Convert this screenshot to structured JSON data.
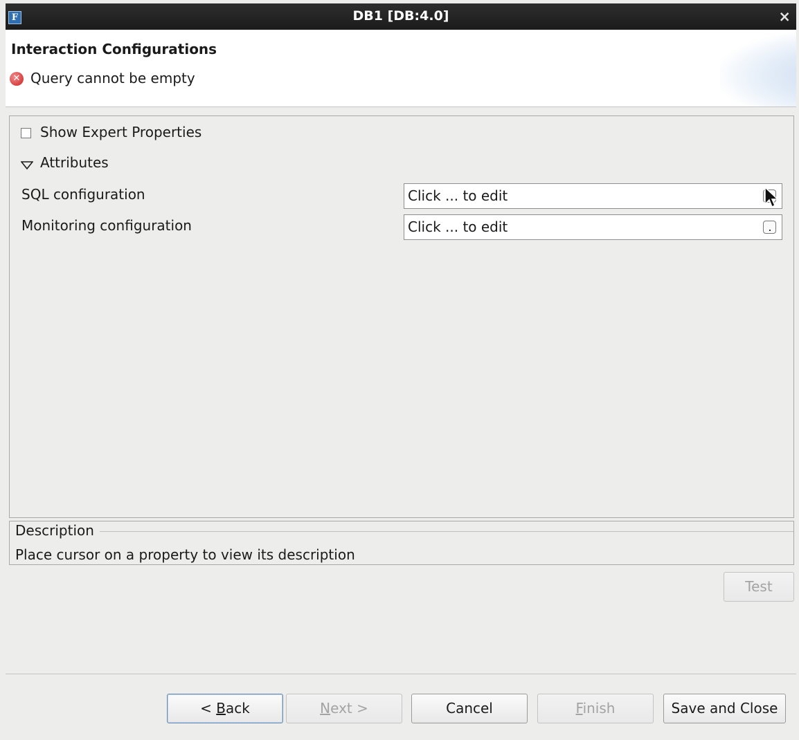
{
  "window": {
    "title": "DB1 [DB:4.0]",
    "app_icon": "F",
    "close_glyph": "×"
  },
  "header": {
    "title": "Interaction Configurations",
    "error_message": "Query cannot be empty",
    "error_icon": "error-icon",
    "error_glyph": "✕"
  },
  "properties": {
    "show_expert_label": "Show Expert Properties",
    "show_expert_checked": false,
    "section_label": "Attributes",
    "section_glyph": "▽",
    "rows": [
      {
        "label": "SQL configuration",
        "value": "Click ... to edit"
      },
      {
        "label": "Monitoring configuration",
        "value": "Click ... to edit"
      }
    ]
  },
  "description": {
    "legend": "Description",
    "text": "Place cursor on a property to view its description"
  },
  "buttons": {
    "test": "Test",
    "back": {
      "prefix": "< ",
      "mnemonic": "B",
      "rest": "ack"
    },
    "next": {
      "mnemonic": "N",
      "rest": "ext >"
    },
    "cancel": "Cancel",
    "finish": {
      "mnemonic": "F",
      "rest": "inish"
    },
    "save_close": "Save and Close"
  }
}
